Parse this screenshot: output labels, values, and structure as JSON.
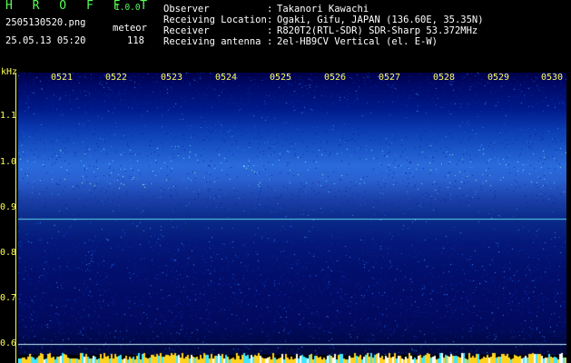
{
  "header": {
    "app_title": "H R O F F T",
    "app_version": "1.0.0",
    "file_name": "2505130520.png",
    "meteor_label": "meteor",
    "date_time": "25.05.13 05:20",
    "meteor_count": "118"
  },
  "info": [
    {
      "label": "Observer",
      "value": "Takanori Kawachi"
    },
    {
      "label": "Receiving Location",
      "value": "Ogaki, Gifu, JAPAN (136.60E, 35.35N)"
    },
    {
      "label": "Receiver",
      "value": "R820T2(RTL-SDR) SDR-Sharp 53.372MHz"
    },
    {
      "label": "Receiving antenna",
      "value": "2el-HB9CV Vertical (el. E-W)"
    }
  ],
  "colon": ":",
  "spectrogram": {
    "y_unit": "kHz",
    "y_ticks": [
      "1.1",
      "1.0",
      "0.9",
      "0.8",
      "0.7",
      "0.6"
    ],
    "x_ticks": [
      "0521",
      "0522",
      "0523",
      "0524",
      "0525",
      "0526",
      "0527",
      "0528",
      "0529",
      "0530"
    ],
    "y_range_khz": [
      0.595,
      1.2
    ],
    "carrier_line_khz": 0.887,
    "lower_line_khz": 0.618,
    "colors": {
      "text_green": "#55ff55",
      "axis_yellow": "#ffff55",
      "carrier_line": "#5fd8e8"
    }
  }
}
